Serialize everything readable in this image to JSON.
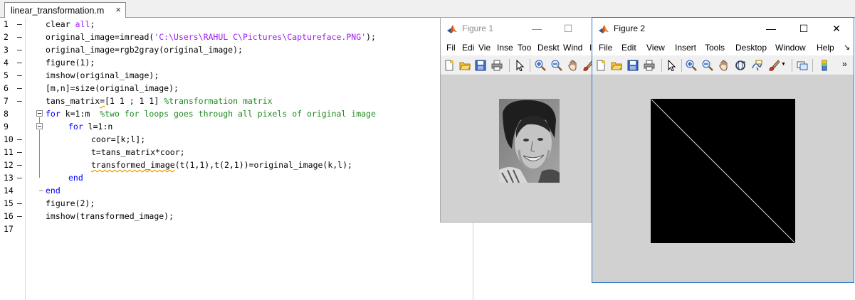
{
  "editor": {
    "tab": {
      "filename": "linear_transformation.m",
      "close": "×"
    },
    "line_numbers": [
      "1",
      "2",
      "3",
      "4",
      "5",
      "6",
      "7",
      "8",
      "9",
      "10",
      "11",
      "12",
      "13",
      "14",
      "15",
      "16",
      "17"
    ],
    "lines": [
      {
        "indent": 0,
        "segments": [
          {
            "t": "clear ",
            "c": "n"
          },
          {
            "t": "all",
            "c": "str"
          },
          {
            "t": ";",
            "c": "n"
          }
        ]
      },
      {
        "indent": 0,
        "segments": [
          {
            "t": "original_image=imread(",
            "c": "n"
          },
          {
            "t": "'C:\\Users\\RAHUL C\\Pictures\\Captureface.PNG'",
            "c": "str"
          },
          {
            "t": ");",
            "c": "n"
          }
        ]
      },
      {
        "indent": 0,
        "segments": [
          {
            "t": "original_image=rgb2gray(original_image);",
            "c": "n"
          }
        ]
      },
      {
        "indent": 0,
        "segments": [
          {
            "t": "figure(1);",
            "c": "n"
          }
        ]
      },
      {
        "indent": 0,
        "segments": [
          {
            "t": "imshow(original_image);",
            "c": "n"
          }
        ]
      },
      {
        "indent": 0,
        "segments": [
          {
            "t": "[m,n]=size(original_image);",
            "c": "n"
          }
        ]
      },
      {
        "indent": 0,
        "segments": [
          {
            "t": "tans_matrix",
            "c": "n"
          },
          {
            "t": "=",
            "c": "squig"
          },
          {
            "t": "[1 1 ; 1 1] ",
            "c": "n"
          },
          {
            "t": "%transformation matrix",
            "c": "cm"
          }
        ]
      },
      {
        "indent": 0,
        "segments": [
          {
            "t": "for ",
            "c": "kw"
          },
          {
            "t": "k=1:m  ",
            "c": "n"
          },
          {
            "t": "%two for loops goes through all pixels of original image",
            "c": "cm"
          }
        ]
      },
      {
        "indent": 1,
        "segments": [
          {
            "t": "for ",
            "c": "kw"
          },
          {
            "t": "l=1:n",
            "c": "n"
          }
        ]
      },
      {
        "indent": 2,
        "segments": [
          {
            "t": "coor=[k;l];",
            "c": "n"
          }
        ]
      },
      {
        "indent": 2,
        "segments": [
          {
            "t": "t=tans_matrix*coor;",
            "c": "n"
          }
        ]
      },
      {
        "indent": 2,
        "segments": [
          {
            "t": "transformed_image",
            "c": "squig"
          },
          {
            "t": "(t(1,1),t(2,1))=original_image(k,l);",
            "c": "n"
          }
        ]
      },
      {
        "indent": 1,
        "segments": [
          {
            "t": "end",
            "c": "kw"
          }
        ]
      },
      {
        "indent": 0,
        "segments": [
          {
            "t": "end",
            "c": "kw"
          }
        ]
      },
      {
        "indent": 0,
        "segments": [
          {
            "t": "figure(2);",
            "c": "n"
          }
        ]
      },
      {
        "indent": 0,
        "segments": [
          {
            "t": "imshow(transformed_image);",
            "c": "n"
          }
        ]
      },
      {
        "indent": 0,
        "segments": []
      }
    ]
  },
  "figure1": {
    "title": "Figure 1",
    "minimize": "—",
    "maximize": "☐",
    "menus": [
      "File",
      "Edit",
      "View",
      "Insert",
      "Tools",
      "Desktop",
      "Window"
    ],
    "menus_visible": [
      "Fil",
      "Edi",
      "Vie",
      "Inse",
      "Too",
      "Deskt",
      "Wind",
      "I"
    ]
  },
  "figure2": {
    "title": "Figure 2",
    "minimize": "—",
    "maximize": "☐",
    "close": "✕",
    "menus": [
      "File",
      "Edit",
      "View",
      "Insert",
      "Tools",
      "Desktop",
      "Window",
      "Help"
    ],
    "menu_overflow": "↘"
  },
  "colors": {
    "keyword": "#0000ff",
    "string": "#a020f0",
    "comment": "#228b22",
    "figure_background": "#d1d1d1",
    "active_window_border": "#2b78c6"
  },
  "icons": [
    "matlab-logo-icon",
    "new-figure-icon",
    "open-file-icon",
    "save-icon",
    "print-icon",
    "pointer-icon",
    "zoom-in-icon",
    "zoom-out-icon",
    "pan-icon",
    "rotate-3d-icon",
    "data-cursor-icon",
    "brush-icon",
    "link-plot-icon",
    "colorbar-icon"
  ]
}
